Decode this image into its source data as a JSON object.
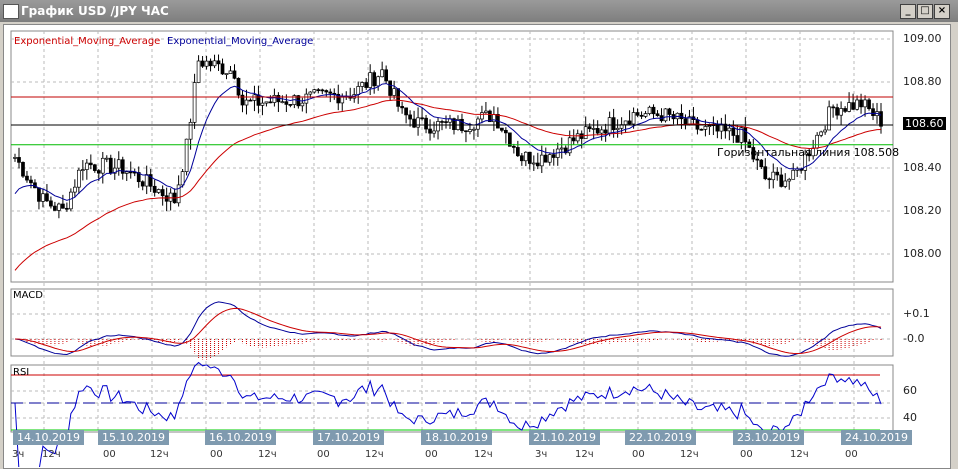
{
  "window": {
    "title": "График USD /JPY  ЧАС",
    "min": "_",
    "max": "□",
    "close": "×"
  },
  "legend": {
    "ema_red": "Exponential_Moving_Average",
    "ema_blue": "Exponential_Moving_Average"
  },
  "hline_label": "Горизонтальная линия 108.508",
  "current_price": "108.60",
  "price_axis": [
    "109.00",
    "108.80",
    "108.60",
    "108.40",
    "108.20",
    "108.00"
  ],
  "macd": {
    "label": "MACD",
    "axis": [
      "+0.1",
      "-0.0"
    ]
  },
  "rsi": {
    "label": "RSI",
    "axis": [
      "60",
      "40"
    ]
  },
  "dates": [
    "14.10.2019",
    "15.10.2019",
    "16.10.2019",
    "17.10.2019",
    "18.10.2019",
    "21.10.2019",
    "22.10.2019",
    "23.10.2019",
    "24.10.2019"
  ],
  "times": [
    "3ч",
    "12ч",
    "00",
    "12ч",
    "00",
    "12ч",
    "00",
    "12ч",
    "00",
    "12ч",
    "3ч",
    "12ч",
    "00",
    "12ч",
    "00",
    "12ч",
    "00"
  ],
  "colors": {
    "ema_red": "#cc0000",
    "ema_blue": "#000099",
    "hline_red": "#c00000",
    "hline_green": "#00bb00"
  },
  "chart_data": {
    "type": "candlestick",
    "ylim": [
      107.88,
      109.05
    ],
    "horizontal_lines": [
      108.73,
      108.6,
      108.508
    ],
    "price_path": [
      [
        0,
        108.45
      ],
      [
        7,
        108.25
      ],
      [
        12,
        108.2
      ],
      [
        17,
        108.42
      ],
      [
        27,
        108.4
      ],
      [
        40,
        108.25
      ],
      [
        43,
        108.5
      ],
      [
        46,
        108.9
      ],
      [
        55,
        108.85
      ],
      [
        57,
        108.7
      ],
      [
        72,
        108.72
      ],
      [
        85,
        108.75
      ],
      [
        92,
        108.85
      ],
      [
        97,
        108.65
      ],
      [
        102,
        108.6
      ],
      [
        112,
        108.6
      ],
      [
        120,
        108.65
      ],
      [
        127,
        108.45
      ],
      [
        132,
        108.45
      ],
      [
        142,
        108.55
      ],
      [
        155,
        108.65
      ],
      [
        162,
        108.65
      ],
      [
        172,
        108.58
      ],
      [
        182,
        108.55
      ],
      [
        188,
        108.35
      ],
      [
        195,
        108.35
      ],
      [
        201,
        108.55
      ],
      [
        205,
        108.68
      ],
      [
        212,
        108.7
      ],
      [
        217,
        108.62
      ]
    ]
  }
}
